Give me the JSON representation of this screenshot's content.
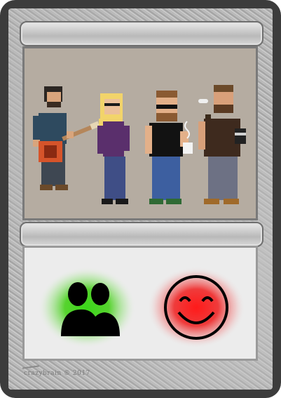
{
  "card": {
    "title_bar": "",
    "type_bar": "",
    "watermark": "crazybrain ® 2017"
  },
  "art": {
    "description_icons": [
      "guitarist-figure",
      "blonde-woman-figure",
      "coffee-drinker-figure",
      "pipe-smoker-figure"
    ]
  },
  "tokens": {
    "left_icon": "group-of-people-icon",
    "left_glow": "#2ecc1f",
    "right_icon": "smiley-face-icon",
    "right_glow": "#f01010"
  }
}
